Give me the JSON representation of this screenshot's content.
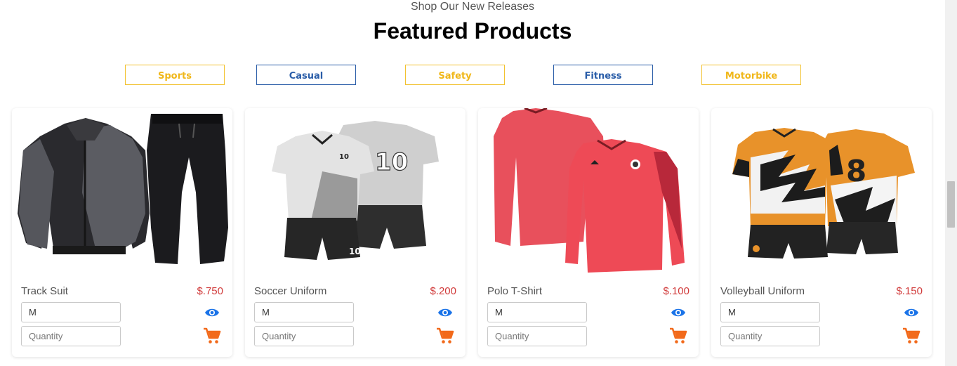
{
  "header": {
    "subtitle": "Shop Our New Releases",
    "title": "Featured Products"
  },
  "categories": [
    {
      "label": "Sports",
      "style": "yellow"
    },
    {
      "label": "Casual",
      "style": "blue"
    },
    {
      "label": "Safety",
      "style": "yellow"
    },
    {
      "label": "Fitness",
      "style": "blue"
    },
    {
      "label": "Motorbike",
      "style": "yellow"
    }
  ],
  "products": [
    {
      "name": "Track Suit",
      "price": "$.750",
      "size_value": "M",
      "quantity_placeholder": "Quantity"
    },
    {
      "name": "Soccer Uniform",
      "price": "$.200",
      "size_value": "M",
      "quantity_placeholder": "Quantity"
    },
    {
      "name": "Polo T-Shirt",
      "price": "$.100",
      "size_value": "M",
      "quantity_placeholder": "Quantity"
    },
    {
      "name": "Volleyball Uniform",
      "price": "$.150",
      "size_value": "M",
      "quantity_placeholder": "Quantity"
    }
  ],
  "icons": {
    "view": "eye-icon",
    "cart": "cart-icon"
  },
  "colors": {
    "accent_yellow": "#f0b71a",
    "accent_blue": "#2a5da8",
    "price_red": "#d13b3b",
    "eye_blue": "#1a73e8",
    "cart_orange": "#f26a1b"
  }
}
